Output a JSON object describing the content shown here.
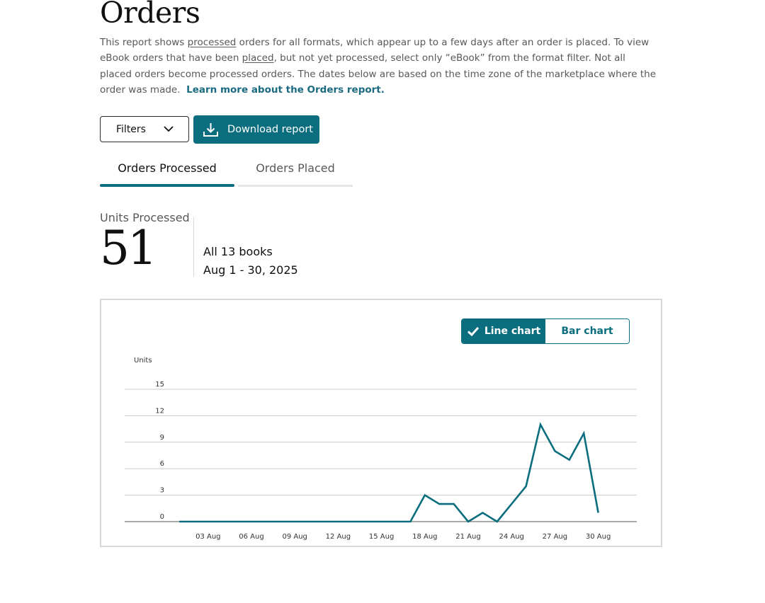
{
  "page": {
    "title": "Orders",
    "description": {
      "part1": "This report shows ",
      "processed_link": "processed",
      "part2": " orders for all formats, which appear up to a few days after an order is placed. To view eBook orders that have been ",
      "placed_link": "placed",
      "part3": ", but not yet processed, select only “eBook” from the format filter. Not all placed orders become processed orders. The dates below are based on the time zone of the marketplace where the order was made.",
      "learn_more": "Learn more about the Orders report."
    }
  },
  "toolbar": {
    "filters_label": "Filters",
    "download_label": "Download report"
  },
  "tabs": [
    {
      "label": "Orders Processed",
      "active": true
    },
    {
      "label": "Orders Placed",
      "active": false
    }
  ],
  "summary": {
    "units_label": "Units Processed",
    "units_value": "51",
    "books": "All 13 books",
    "date_range": "Aug 1 - 30, 2025"
  },
  "chart_toggle": {
    "line_label": "Line chart",
    "bar_label": "Bar chart",
    "selected": "line"
  },
  "colors": {
    "accent": "#0b6e7f",
    "gridline": "#cccccc",
    "axis": "#555555"
  },
  "icons": {
    "filters_chevron": "chevron-down-icon",
    "download": "download-icon",
    "line_chart_check": "check-icon"
  },
  "chart_data": {
    "type": "line",
    "ylabel": "Units",
    "ylim": [
      0,
      15
    ],
    "yticks": [
      0,
      3,
      6,
      9,
      12,
      15
    ],
    "x": [
      "01 Aug",
      "02 Aug",
      "03 Aug",
      "04 Aug",
      "05 Aug",
      "06 Aug",
      "07 Aug",
      "08 Aug",
      "09 Aug",
      "10 Aug",
      "11 Aug",
      "12 Aug",
      "13 Aug",
      "14 Aug",
      "15 Aug",
      "16 Aug",
      "17 Aug",
      "18 Aug",
      "19 Aug",
      "20 Aug",
      "21 Aug",
      "22 Aug",
      "23 Aug",
      "24 Aug",
      "25 Aug",
      "26 Aug",
      "27 Aug",
      "28 Aug",
      "29 Aug",
      "30 Aug"
    ],
    "xtick_labels": [
      "03 Aug",
      "06 Aug",
      "09 Aug",
      "12 Aug",
      "15 Aug",
      "18 Aug",
      "21 Aug",
      "24 Aug",
      "27 Aug",
      "30 Aug"
    ],
    "series": [
      {
        "values": [
          0,
          0,
          0,
          0,
          0,
          0,
          0,
          0,
          0,
          0,
          0,
          0,
          0,
          0,
          0,
          0,
          0,
          3,
          2,
          2,
          0,
          1,
          0,
          2,
          4,
          11,
          8,
          7,
          10,
          1
        ]
      }
    ],
    "grid": true,
    "legend": "none"
  }
}
